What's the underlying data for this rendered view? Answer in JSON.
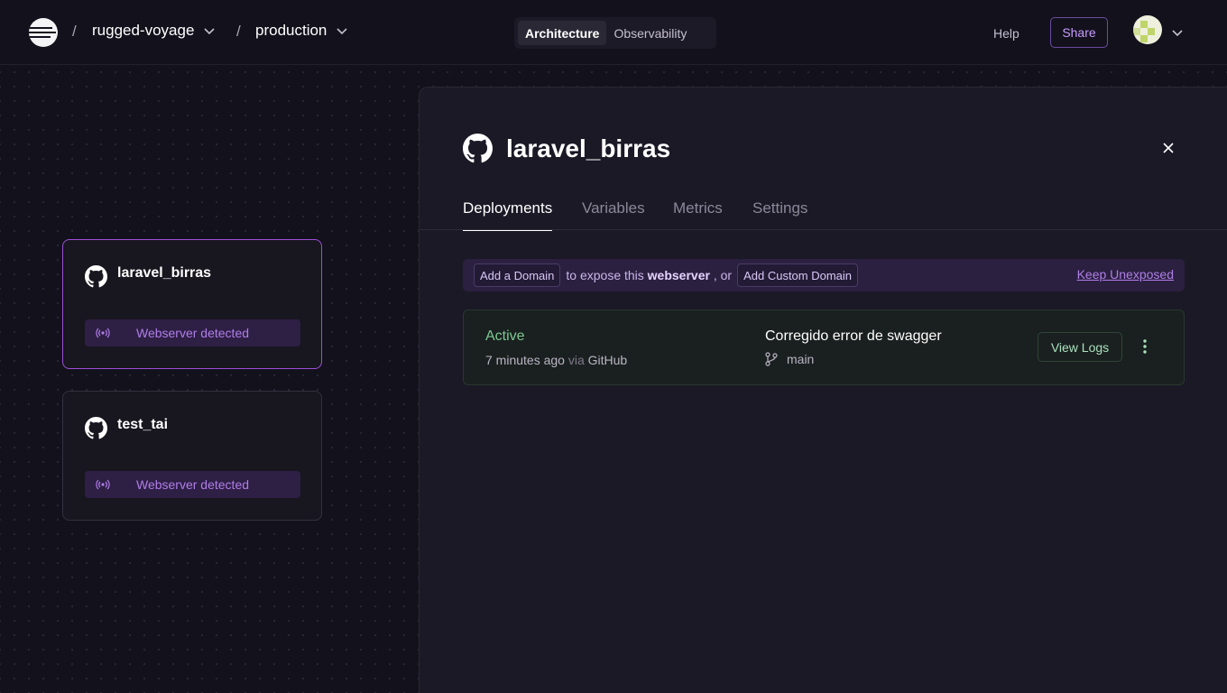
{
  "header": {
    "project_name": "rugged-voyage",
    "environment_name": "production",
    "separator": "/",
    "nav_tabs": [
      {
        "label": "Architecture",
        "active": true
      },
      {
        "label": "Observability",
        "active": false
      }
    ],
    "help_label": "Help",
    "share_label": "Share"
  },
  "canvas": {
    "services": [
      {
        "name": "laravel_birras",
        "badge": "Webserver detected",
        "selected": true,
        "icon": "github-icon"
      },
      {
        "name": "test_tai",
        "badge": "Webserver detected",
        "selected": false,
        "icon": "github-icon"
      }
    ]
  },
  "panel": {
    "title": "laravel_birras",
    "icon": "github-icon",
    "tabs": [
      {
        "label": "Deployments",
        "active": true
      },
      {
        "label": "Variables",
        "active": false
      },
      {
        "label": "Metrics",
        "active": false
      },
      {
        "label": "Settings",
        "active": false
      }
    ],
    "domain_bar": {
      "add_domain_label": "Add a Domain",
      "text_before": "to expose this",
      "bold_word": "webserver",
      "text_after": ", or",
      "add_custom_label": "Add Custom Domain",
      "keep_label": "Keep Unexposed"
    },
    "deployment": {
      "status": "Active",
      "time_ago": "7 minutes ago",
      "via_word": "via",
      "source": "GitHub",
      "commit_message": "Corregido error de swagger",
      "branch": "main",
      "view_logs_label": "View Logs"
    }
  },
  "colors": {
    "background": "#13111c",
    "accent_purple": "#b07ee8",
    "active_green": "#7cc892",
    "panel_bg": "#1b1926"
  }
}
